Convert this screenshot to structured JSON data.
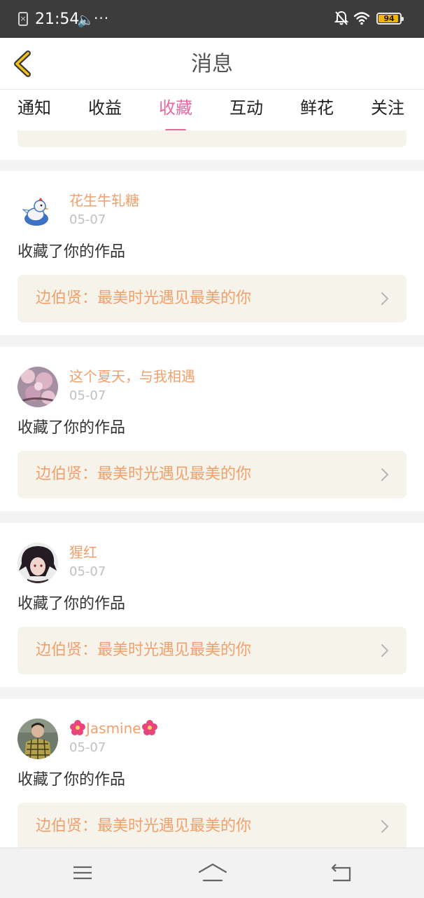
{
  "status_bar": {
    "sim_glyph": "×",
    "time": "21:54",
    "volume_glyph": "🔈",
    "more_glyph": "···",
    "battery_level": "94",
    "battery_fraction": 0.94
  },
  "header": {
    "title": "消息",
    "back_icon": "back-chevron-icon"
  },
  "tabs": [
    {
      "label": "通知"
    },
    {
      "label": "收益"
    },
    {
      "label": "收藏",
      "active": true
    },
    {
      "label": "互动"
    },
    {
      "label": "鲜花"
    },
    {
      "label": "关注"
    }
  ],
  "notifications": [
    {
      "user": "花生牛轧糖",
      "date": "05-07",
      "action": "收藏了你的作品",
      "work": "边伯贤：最美时光遇见最美的你",
      "avatar": "cartoon-bird-avatar"
    },
    {
      "user": "这个夏天，与我相遇",
      "date": "05-07",
      "action": "收藏了你的作品",
      "work": "边伯贤：最美时光遇见最美的你",
      "avatar": "cherry-blossom-avatar"
    },
    {
      "user": "猩红",
      "date": "05-07",
      "action": "收藏了你的作品",
      "work": "边伯贤：最美时光遇见最美的你",
      "avatar": "dark-hair-character-avatar"
    },
    {
      "user": "Jasmine",
      "date": "05-07",
      "action": "收藏了你的作品",
      "work": "边伯贤：最美时光遇见最美的你",
      "avatar": "person-in-plaid-avatar"
    }
  ],
  "colors": {
    "accent": "#e56aa0",
    "username": "#f0a06c",
    "work_bg": "#f6f4ea",
    "status_bar": "#3c3c3c",
    "battery": "#f3b300"
  },
  "nav_bar": {
    "icons": [
      "menu-icon",
      "home-icon",
      "back-icon"
    ]
  }
}
